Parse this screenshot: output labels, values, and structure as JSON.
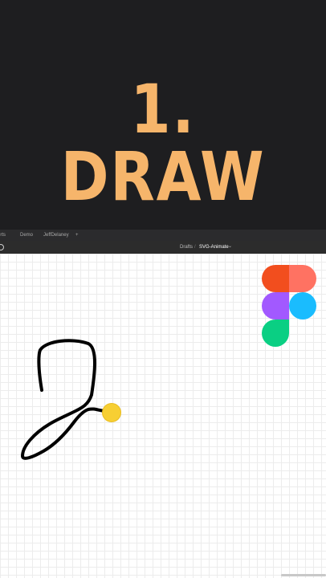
{
  "title_card": {
    "heading": "1. DRAW",
    "color": "#f6b56b"
  },
  "tabs": [
    {
      "label": "orts"
    },
    {
      "label": "Demo"
    },
    {
      "label": "JeffDelaney"
    },
    {
      "label": "+"
    }
  ],
  "toolbar": {
    "breadcrumb_parent": "Drafts",
    "separator": "/",
    "file_name": "SVG-Animate",
    "file_menu_chevron": "⌄"
  },
  "canvas": {
    "background": "#ffffff",
    "figma_logo_colors": [
      "#f24e1e",
      "#ff7262",
      "#a259ff",
      "#1abcfe",
      "#0acf83"
    ],
    "stroke_color": "#000000",
    "cursor_color": "#f7cf33"
  }
}
